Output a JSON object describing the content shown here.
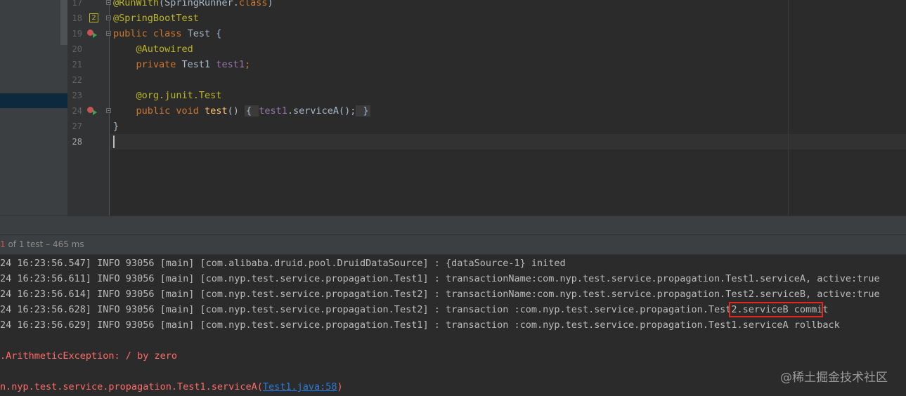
{
  "editor": {
    "lines": [
      {
        "num": "17",
        "parts": [
          [
            "ann",
            "@RunWith"
          ],
          [
            "plain",
            "(SpringRunner."
          ],
          [
            "kw",
            "class"
          ],
          [
            "plain",
            ")"
          ]
        ]
      },
      {
        "num": "18",
        "badge": "2",
        "parts": [
          [
            "ann",
            "@SpringBootTest"
          ]
        ]
      },
      {
        "num": "19",
        "parts": [
          [
            "kw",
            "public class "
          ],
          [
            "plain",
            "Test {"
          ]
        ]
      },
      {
        "num": "20",
        "parts": [
          [
            "plain",
            "    "
          ],
          [
            "ann",
            "@Autowired"
          ]
        ]
      },
      {
        "num": "21",
        "parts": [
          [
            "plain",
            "    "
          ],
          [
            "kw",
            "private "
          ],
          [
            "plain",
            "Test1 "
          ],
          [
            "fld",
            "test1"
          ],
          [
            "kw",
            ";"
          ]
        ]
      },
      {
        "num": "22",
        "parts": []
      },
      {
        "num": "23",
        "parts": [
          [
            "plain",
            "    "
          ],
          [
            "ann",
            "@org.junit.Test"
          ]
        ]
      },
      {
        "num": "24",
        "parts": [
          [
            "plain",
            "    "
          ],
          [
            "kw",
            "public void "
          ],
          [
            "fn",
            "test"
          ],
          [
            "plain",
            "() "
          ]
        ],
        "folded": [
          "{ ",
          "test1",
          ".serviceA();",
          " }"
        ]
      },
      {
        "num": "27",
        "parts": [
          [
            "plain",
            "}"
          ]
        ]
      },
      {
        "num": "28",
        "parts": []
      }
    ]
  },
  "run_status": {
    "passed": "1",
    "rest": " of 1 test – 465 ms"
  },
  "console": {
    "lines": [
      "24 16:23:56.547] INFO 93056 [main] [com.alibaba.druid.pool.DruidDataSource] : {dataSource-1} inited",
      "24 16:23:56.611] INFO 93056 [main] [com.nyp.test.service.propagation.Test1] : transactionName:com.nyp.test.service.propagation.Test1.serviceA, active:true",
      "24 16:23:56.614] INFO 93056 [main] [com.nyp.test.service.propagation.Test2] : transactionName:com.nyp.test.service.propagation.Test2.serviceB, active:true",
      "24 16:23:56.628] INFO 93056 [main] [com.nyp.test.service.propagation.Test2] : transaction :com.nyp.test.service.propagation.Test2.serviceB commit",
      "24 16:23:56.629] INFO 93056 [main] [com.nyp.test.service.propagation.Test1] : transaction :com.nyp.test.service.propagation.Test1.serviceA rollback"
    ],
    "exception": ".ArithmeticException: / by zero",
    "stack_prefix": "n.nyp.test.service.propagation.Test1.serviceA(",
    "stack_link": "Test1.java:58",
    "stack_suffix": ")"
  },
  "watermark": "@稀土掘金技术社区",
  "icons": {
    "run_test": "run-test-icon",
    "fold": "fold-icon"
  }
}
